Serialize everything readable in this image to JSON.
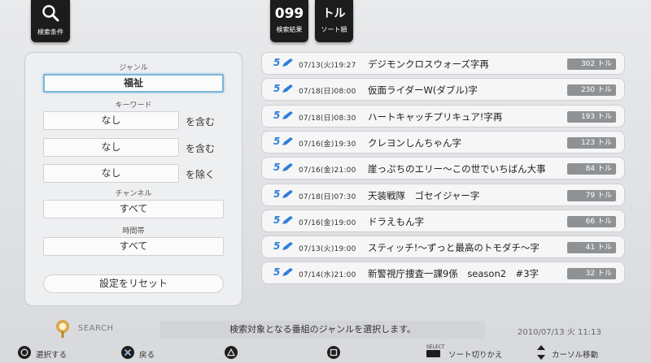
{
  "top": {
    "search_label": "検索条件",
    "count_value": "099",
    "count_label": "検索結果",
    "sort_value": "トル",
    "sort_label": "ソート順"
  },
  "left": {
    "genre_label": "ジャンル",
    "genre_value": "福祉",
    "keyword_label": "キーワード",
    "keywords": [
      {
        "value": "なし",
        "condition": "を含む"
      },
      {
        "value": "なし",
        "condition": "を含む"
      },
      {
        "value": "なし",
        "condition": "を除く"
      }
    ],
    "channel_label": "チャンネル",
    "channel_value": "すべて",
    "time_label": "時間帯",
    "time_value": "すべて",
    "reset_label": "設定をリセット"
  },
  "programs": [
    {
      "ch": "5",
      "datetime": "07/13(火)19:27",
      "title": "デジモンクロスウォーズ字再",
      "count": "302 トル"
    },
    {
      "ch": "5",
      "datetime": "07/18(日)08:00",
      "title": "仮面ライダーW(ダブル)字",
      "count": "230 トル"
    },
    {
      "ch": "5",
      "datetime": "07/18(日)08:30",
      "title": "ハートキャッチプリキュア!字再",
      "count": "193 トル"
    },
    {
      "ch": "5",
      "datetime": "07/16(金)19:30",
      "title": "クレヨンしんちゃん字",
      "count": "123 トル"
    },
    {
      "ch": "5",
      "datetime": "07/16(金)21:00",
      "title": "崖っぷちのエリー～この世でいちばん大事",
      "count": "84 トル"
    },
    {
      "ch": "5",
      "datetime": "07/18(日)07:30",
      "title": "天装戦隊　ゴセイジャー字",
      "count": "79 トル"
    },
    {
      "ch": "5",
      "datetime": "07/16(金)19:00",
      "title": "ドラえもん字",
      "count": "66 トル"
    },
    {
      "ch": "5",
      "datetime": "07/13(火)19:00",
      "title": "スティッチ!～ずっと最高のトモダチ～字",
      "count": "41 トル"
    },
    {
      "ch": "5",
      "datetime": "07/14(水)21:00",
      "title": "新警視庁捜査一課9係　season2　#3字",
      "count": "32 トル"
    }
  ],
  "bottom": {
    "search_text": "SEARCH",
    "help_text": "検索対象となる番組のジャンルを選択します。",
    "datetime": "2010/07/13 火 11:13"
  },
  "footer": {
    "circle_label": "選択する",
    "cross_label": "戻る",
    "select_key": "SELECT",
    "select_label": "ソート切りかえ",
    "dpad_label": "カーソル移動"
  },
  "colors": {
    "accent": "#79b6d8",
    "channel_blue": "#2f7ed8",
    "count_badge": "#8f9295"
  }
}
